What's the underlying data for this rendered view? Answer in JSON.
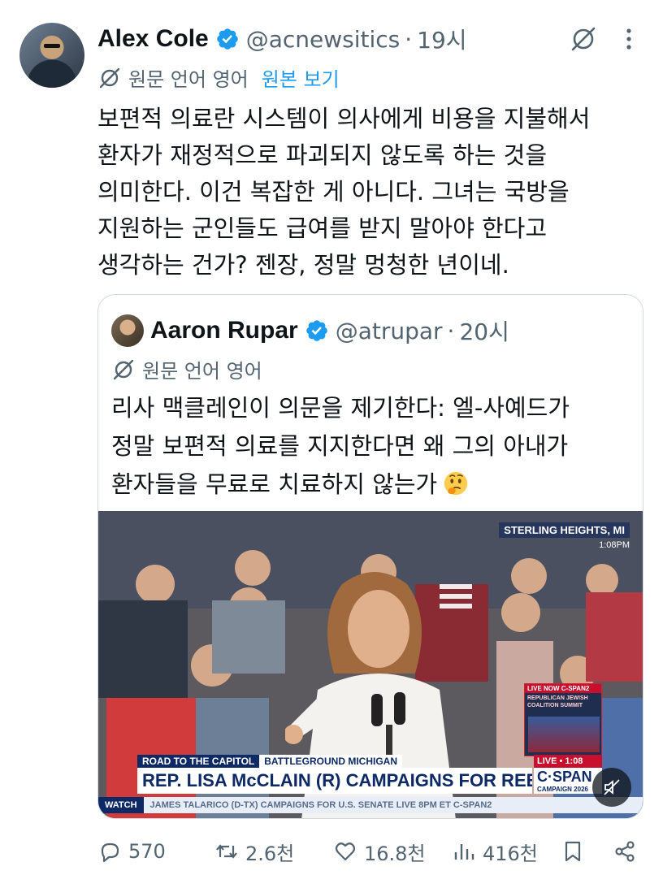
{
  "author": {
    "name": "Alex Cole",
    "handle": "@acnewsitics",
    "separator": "·",
    "time": "19시"
  },
  "translation": {
    "label": "원문 언어 영어",
    "show_original": "원본 보기"
  },
  "tweet_lines": [
    "보편적 의료란 시스템이 의사에게 비용을 지불해서",
    "환자가 재정적으로 파괴되지 않도록 하는 것을",
    "의미한다. 이건 복잡한 게 아니다. 그녀는 국방을",
    "지원하는 군인들도 급여를 받지 말아야 한다고",
    "생각하는 건가? 젠장, 정말 멍청한 년이네."
  ],
  "quoted": {
    "name": "Aaron Rupar",
    "handle": "@atrupar",
    "separator": "·",
    "time": "20시",
    "translation_label": "원문 언어 영어",
    "lines": [
      "리사 맥클레인이 의문을 제기한다: 엘-사예드가",
      "정말 보편적 의료를 지지한다면 왜 그의 아내가",
      "환자들을 무료로 치료하지 않는가"
    ],
    "emoji": "thinking-face",
    "video": {
      "location": "STERLING HEIGHTS, MI",
      "clock": "1:08",
      "clock_suffix": "PM",
      "pip_live": "LIVE NOW C-SPAN2",
      "pip_title": "REPUBLICAN JEWISH COALITION SUMMIT",
      "chyron_top_a": "ROAD TO THE CAPITOL",
      "chyron_top_b": "BATTLEGROUND MICHIGAN",
      "chyron_main": "REP. LISA McCLAIN (R) CAMPAIGNS FOR REELECTION",
      "live_label": "LIVE • 1:08",
      "network": "C·SPAN",
      "network_sub": "CAMPAIGN 2026",
      "ticker_label": "WATCH",
      "ticker_text": "JAMES TALARICO (D-TX) CAMPAIGNS FOR U.S. SENATE  LIVE 8PM ET C-SPAN2"
    }
  },
  "actions": {
    "replies": "570",
    "reposts": "2.6천",
    "likes": "16.8천",
    "views": "416천"
  },
  "colors": {
    "accent": "#1d9bf0",
    "muted": "#536471",
    "text": "#0f1419",
    "border": "#cfd9de"
  }
}
